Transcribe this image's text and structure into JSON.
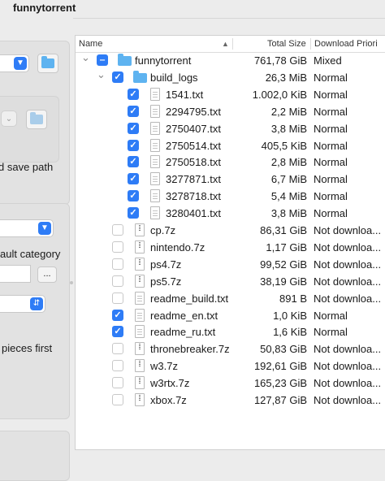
{
  "window": {
    "title": "funnytorrent"
  },
  "left_panel": {
    "save_path_label": "d save path",
    "category_label": "ault category",
    "browse_label": "...",
    "sequential_label": " pieces first"
  },
  "tree": {
    "columns": {
      "name": "Name",
      "size": "Total Size",
      "priority": "Download Priori"
    },
    "sort_indicator": "▲",
    "rows": [
      {
        "name": "funnytorrent",
        "size": "761,78 GiB",
        "priority": "Mixed",
        "check": "partial",
        "icon": "folder-icon",
        "depth": 0,
        "expanded": true
      },
      {
        "name": "build_logs",
        "size": "26,3 MiB",
        "priority": "Normal",
        "check": "on",
        "icon": "folder-icon",
        "depth": 1,
        "expanded": true
      },
      {
        "name": "1541.txt",
        "size": "1.002,0 KiB",
        "priority": "Normal",
        "check": "on",
        "icon": "text-file-icon",
        "depth": 2
      },
      {
        "name": "2294795.txt",
        "size": "2,2 MiB",
        "priority": "Normal",
        "check": "on",
        "icon": "text-file-icon",
        "depth": 2
      },
      {
        "name": "2750407.txt",
        "size": "3,8 MiB",
        "priority": "Normal",
        "check": "on",
        "icon": "text-file-icon",
        "depth": 2
      },
      {
        "name": "2750514.txt",
        "size": "405,5 KiB",
        "priority": "Normal",
        "check": "on",
        "icon": "text-file-icon",
        "depth": 2
      },
      {
        "name": "2750518.txt",
        "size": "2,8 MiB",
        "priority": "Normal",
        "check": "on",
        "icon": "text-file-icon",
        "depth": 2
      },
      {
        "name": "3277871.txt",
        "size": "6,7 MiB",
        "priority": "Normal",
        "check": "on",
        "icon": "text-file-icon",
        "depth": 2
      },
      {
        "name": "3278718.txt",
        "size": "5,4 MiB",
        "priority": "Normal",
        "check": "on",
        "icon": "text-file-icon",
        "depth": 2
      },
      {
        "name": "3280401.txt",
        "size": "3,8 MiB",
        "priority": "Normal",
        "check": "on",
        "icon": "text-file-icon",
        "depth": 2
      },
      {
        "name": "cp.7z",
        "size": "86,31 GiB",
        "priority": "Not downloa...",
        "check": "off",
        "icon": "archive-file-icon",
        "depth": 1
      },
      {
        "name": "nintendo.7z",
        "size": "1,17 GiB",
        "priority": "Not downloa...",
        "check": "off",
        "icon": "archive-file-icon",
        "depth": 1
      },
      {
        "name": "ps4.7z",
        "size": "99,52 GiB",
        "priority": "Not downloa...",
        "check": "off",
        "icon": "archive-file-icon",
        "depth": 1
      },
      {
        "name": "ps5.7z",
        "size": "38,19 GiB",
        "priority": "Not downloa...",
        "check": "off",
        "icon": "archive-file-icon",
        "depth": 1
      },
      {
        "name": "readme_build.txt",
        "size": "891 B",
        "priority": "Not downloa...",
        "check": "off",
        "icon": "text-file-icon",
        "depth": 1
      },
      {
        "name": "readme_en.txt",
        "size": "1,0 KiB",
        "priority": "Normal",
        "check": "on",
        "icon": "text-file-icon",
        "depth": 1
      },
      {
        "name": "readme_ru.txt",
        "size": "1,6 KiB",
        "priority": "Normal",
        "check": "on",
        "icon": "text-file-icon",
        "depth": 1
      },
      {
        "name": "thronebreaker.7z",
        "size": "50,83 GiB",
        "priority": "Not downloa...",
        "check": "off",
        "icon": "archive-file-icon",
        "depth": 1
      },
      {
        "name": "w3.7z",
        "size": "192,61 GiB",
        "priority": "Not downloa...",
        "check": "off",
        "icon": "archive-file-icon",
        "depth": 1
      },
      {
        "name": "w3rtx.7z",
        "size": "165,23 GiB",
        "priority": "Not downloa...",
        "check": "off",
        "icon": "archive-file-icon",
        "depth": 1
      },
      {
        "name": "xbox.7z",
        "size": "127,87 GiB",
        "priority": "Not downloa...",
        "check": "off",
        "icon": "archive-file-icon",
        "depth": 1
      }
    ]
  },
  "colors": {
    "accent": "#2e7cf6",
    "folder": "#5eb3f0"
  }
}
